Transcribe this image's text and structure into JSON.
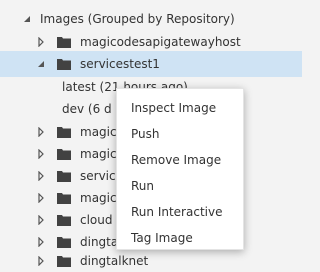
{
  "tree": {
    "root_label": "Images (Grouped by Repository)",
    "repositories": [
      {
        "label": "magicodesapigatewayhost",
        "expanded": false
      },
      {
        "label": "servicestest1",
        "expanded": true,
        "selected": true,
        "tags": [
          {
            "label": "latest (21 hours ago)"
          },
          {
            "label": "dev (6 d"
          }
        ]
      },
      {
        "label": "magic",
        "expanded": false
      },
      {
        "label": "magic",
        "expanded": false
      },
      {
        "label": "servic",
        "expanded": false
      },
      {
        "label": "magic",
        "expanded": false
      },
      {
        "label": "cloud",
        "expanded": false
      },
      {
        "label": "dingta",
        "expanded": false
      },
      {
        "label": "dingtalknet",
        "expanded": false
      }
    ]
  },
  "context_menu": {
    "items": [
      {
        "label": "Inspect Image"
      },
      {
        "label": "Push"
      },
      {
        "label": "Remove Image"
      },
      {
        "label": "Run"
      },
      {
        "label": "Run Interactive"
      },
      {
        "label": "Tag Image"
      }
    ]
  },
  "colors": {
    "background": "#f3f3f3",
    "selection": "#cfe3f4",
    "text": "#333333",
    "menu_background": "#ffffff"
  },
  "icons": {
    "expanded": "chevron-down-icon",
    "collapsed": "chevron-right-icon",
    "repository": "folder-icon"
  }
}
